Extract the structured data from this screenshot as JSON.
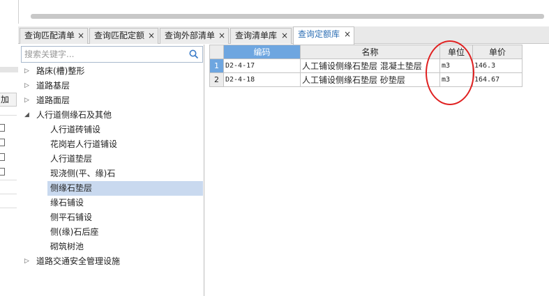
{
  "tabs": [
    {
      "label": "查询匹配清单",
      "close": "×"
    },
    {
      "label": "查询匹配定额",
      "close": "×"
    },
    {
      "label": "查询外部清单",
      "close": "×"
    },
    {
      "label": "查询清单库",
      "close": "×"
    },
    {
      "label": "查询定额库",
      "close": "×",
      "active": true
    }
  ],
  "left_strip": {
    "label": "加"
  },
  "search": {
    "placeholder": "搜索关键字..."
  },
  "tree": [
    {
      "label": "路床(槽)整形",
      "arrow": "▷",
      "level": 0
    },
    {
      "label": "道路基层",
      "arrow": "▷",
      "level": 0
    },
    {
      "label": "道路面层",
      "arrow": "▷",
      "level": 0
    },
    {
      "label": "人行道侧缘石及其他",
      "arrow": "◢",
      "level": 0
    },
    {
      "label": "人行道砖铺设",
      "level": 1
    },
    {
      "label": "花岗岩人行道铺设",
      "level": 1
    },
    {
      "label": "人行道垫层",
      "level": 1
    },
    {
      "label": "现浇侧(平、缘)石",
      "level": 1
    },
    {
      "label": "侧缘石垫层",
      "level": 1,
      "selected": true
    },
    {
      "label": "缘石铺设",
      "level": 1
    },
    {
      "label": "侧平石铺设",
      "level": 1
    },
    {
      "label": "侧(缘)石后座",
      "level": 1
    },
    {
      "label": "砌筑树池",
      "level": 1
    },
    {
      "label": "道路交通安全管理设施",
      "arrow": "▷",
      "level": 0
    }
  ],
  "grid": {
    "headers": {
      "code": "编码",
      "name": "名称",
      "unit": "单位",
      "price": "单价"
    },
    "rows": [
      {
        "num": "1",
        "code": "D2-4-17",
        "name": "人工铺设侧缘石垫层 混凝土垫层",
        "unit": "m3",
        "price": "146.3"
      },
      {
        "num": "2",
        "code": "D2-4-18",
        "name": "人工铺设侧缘石垫层 砂垫层",
        "unit": "m3",
        "price": "164.67"
      }
    ]
  },
  "colors": {
    "accent": "#2e6fb4",
    "selected_header": "#6ea6e0",
    "annotation": "#e02020"
  }
}
